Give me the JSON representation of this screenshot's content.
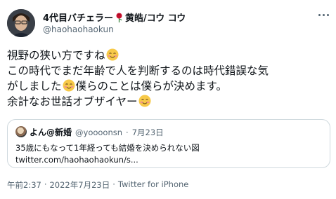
{
  "author": {
    "display_name_prefix": "4代目バチェラー",
    "display_name_suffix": "黄皓/コウ コウ",
    "handle": "@haohaohaokun",
    "avatar_icon": "user-avatar-photo",
    "name_emoji": "rose-icon"
  },
  "tweet": {
    "lines": [
      "視野の狭い方ですね",
      "この時代でまだ年齢で人を判断するのは時代錯誤な気",
      "がしました",
      "僕らのことは僕らが決めます。",
      "余計なお世話オブザイヤー"
    ],
    "emoji": "smiling-face-with-smiling-eyes"
  },
  "quote": {
    "name": "よん@新婚",
    "handle": "@yoooonsn",
    "separator": "·",
    "date": "7月23日",
    "text": "35歳にもなって1年経っても結婚を決められない図",
    "link": "twitter.com/haohaohaokun/s..."
  },
  "meta": {
    "time": "午前2:37",
    "separator": "·",
    "date": "2022年7月23日",
    "separator2": "·",
    "source": "Twitter for iPhone"
  },
  "colors": {
    "text": "#0f1419",
    "secondary": "#536471",
    "border": "#cfd9de",
    "rose": "#c8102e"
  }
}
